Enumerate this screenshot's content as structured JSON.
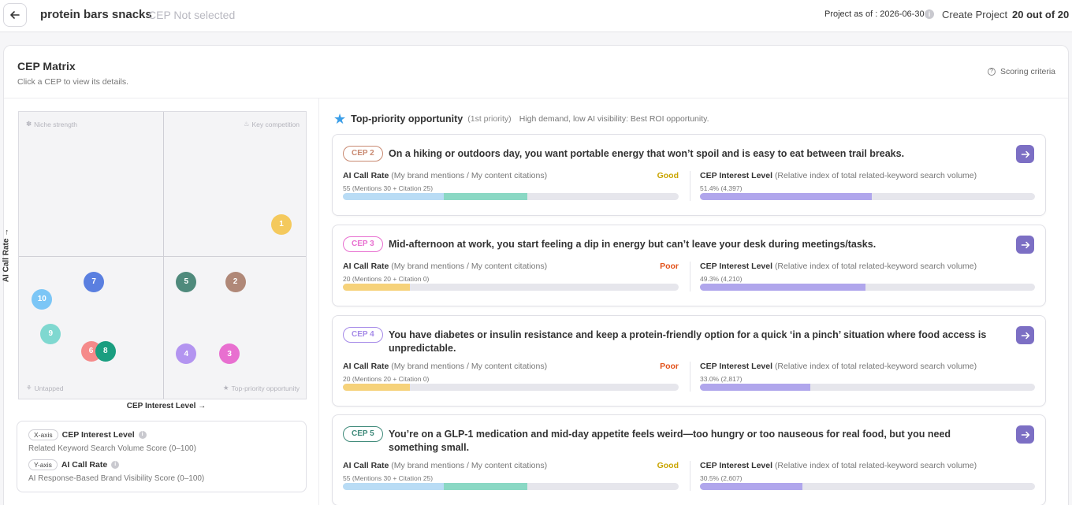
{
  "header": {
    "title": "protein bars snacks",
    "cep_status": "CEP Not selected",
    "project_as_of": "Project as of : 2026-06-30",
    "create_project": "Create Project",
    "quota": "20 out of 20"
  },
  "panel": {
    "title": "CEP Matrix",
    "subtitle": "Click a CEP to view its details.",
    "scoring": "Scoring criteria"
  },
  "matrix": {
    "quadrants": {
      "top_left": "Niche strength",
      "top_right": "Key competition",
      "bottom_left": "Untapped",
      "bottom_right": "Top-priority opportunity"
    },
    "y_axis": "AI Call Rate →",
    "x_axis": "CEP Interest Level →",
    "points": [
      {
        "label": "1",
        "x": 91,
        "y": 61,
        "color": "#f4c95d"
      },
      {
        "label": "2",
        "x": 75,
        "y": 41,
        "color": "#b08878"
      },
      {
        "label": "3",
        "x": 73,
        "y": 16,
        "color": "#e86fd0"
      },
      {
        "label": "4",
        "x": 58,
        "y": 16,
        "color": "#b394f0"
      },
      {
        "label": "5",
        "x": 58,
        "y": 41,
        "color": "#4f8a7c"
      },
      {
        "label": "6",
        "x": 25,
        "y": 17,
        "color": "#f58a8a"
      },
      {
        "label": "7",
        "x": 26,
        "y": 41,
        "color": "#5a7fe0"
      },
      {
        "label": "8",
        "x": 30,
        "y": 17,
        "color": "#1a9e80"
      },
      {
        "label": "9",
        "x": 11,
        "y": 23,
        "color": "#7fd8d0"
      },
      {
        "label": "10",
        "x": 8,
        "y": 35,
        "color": "#7cc6f6"
      }
    ]
  },
  "legend": {
    "x_pill": "X-axis",
    "x_name": "CEP Interest Level",
    "x_desc": "Related Keyword Search Volume Score (0–100)",
    "y_pill": "Y-axis",
    "y_name": "AI Call Rate",
    "y_desc": "AI Response-Based Brand Visibility Score (0–100)"
  },
  "priority": {
    "title": "Top-priority opportunity",
    "rank": "(1st priority)",
    "desc": "High demand, low AI visibility: Best ROI opportunity."
  },
  "metric_labels": {
    "ai_name": "AI Call Rate",
    "ai_hint": "(My brand mentions / My content citations)",
    "interest_name": "CEP Interest Level",
    "interest_hint": "(Relative index of total related-keyword search volume)"
  },
  "cards": [
    {
      "tag": "CEP 2",
      "tag_color": "#c98a72",
      "text": "On a hiking or outdoors day, you want portable energy that won’t spoil and is easy to eat between trail breaks.",
      "rating": "Good",
      "rating_color": "#c9a400",
      "ai_sub": "55 (Mentions 30 + Citation 25)",
      "ai_mentions_pct": 30,
      "ai_citation_pct": 25,
      "interest_sub": "51.4% (4,397)",
      "interest_pct": 51.4
    },
    {
      "tag": "CEP 3",
      "tag_color": "#e86fd0",
      "text": "Mid-afternoon at work, you start feeling a dip in energy but can’t leave your desk during meetings/tasks.",
      "rating": "Poor",
      "rating_color": "#e2531c",
      "ai_sub": "20 (Mentions 20 + Citation 0)",
      "ai_mentions_pct": 20,
      "ai_citation_pct": 0,
      "interest_sub": "49.3% (4,210)",
      "interest_pct": 49.3
    },
    {
      "tag": "CEP 4",
      "tag_color": "#a58ae8",
      "text": "You have diabetes or insulin resistance and keep a protein-friendly option for a quick ‘in a pinch’ situation where food access is unpredictable.",
      "rating": "Poor",
      "rating_color": "#e2531c",
      "ai_sub": "20 (Mentions 20 + Citation 0)",
      "ai_mentions_pct": 20,
      "ai_citation_pct": 0,
      "interest_sub": "33.0% (2,817)",
      "interest_pct": 33.0
    },
    {
      "tag": "CEP 5",
      "tag_color": "#3f8a7a",
      "text": "You’re on a GLP-1 medication and mid-day appetite feels weird—too hungry or too nauseous for real food, but you need something small.",
      "rating": "Good",
      "rating_color": "#c9a400",
      "ai_sub": "55 (Mentions 30 + Citation 25)",
      "ai_mentions_pct": 30,
      "ai_citation_pct": 25,
      "interest_sub": "30.5% (2,607)",
      "interest_pct": 30.5
    }
  ]
}
